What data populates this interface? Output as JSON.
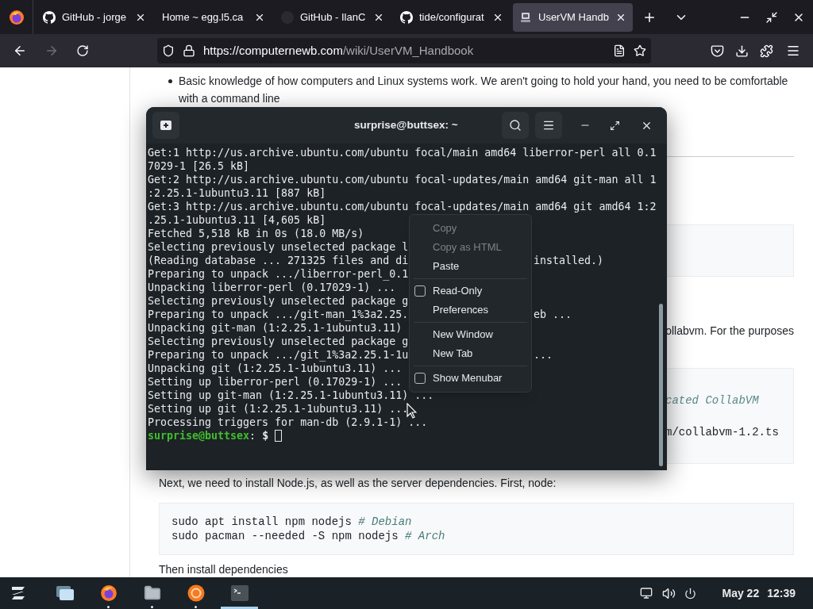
{
  "browser": {
    "tabs": [
      {
        "title": "GitHub - jorge",
        "kind": "github",
        "selected": false
      },
      {
        "title": "Home ~ egg.l5.ca",
        "kind": "plain",
        "selected": false
      },
      {
        "title": "GitHub - IlanC",
        "kind": "dark",
        "selected": false
      },
      {
        "title": "tide/configurat",
        "kind": "github",
        "selected": false
      },
      {
        "title": "UserVM Handb",
        "kind": "site",
        "selected": true
      }
    ],
    "url": {
      "host": "https://computernewb.com",
      "path": "/wiki/UserVM_Handbook"
    }
  },
  "page": {
    "bullet": "Basic knowledge of how computers and Linux systems work. We aren't going to hold your hand, you need to be comfortable with a command line",
    "fragment_paragraph": "ollabvm. For the purposes",
    "code_fragments": [
      {
        "text": "cated CollabVM",
        "kind": "comment"
      },
      {
        "text": "m/collabvm-1.2.ts",
        "kind": "command"
      }
    ],
    "intro": "Next, we need to install Node.js, as well as the server dependencies. First, node:",
    "code": [
      {
        "command": "sudo apt install npm nodejs",
        "comment": "# Debian"
      },
      {
        "command": "sudo pacman --needed -S npm nodejs",
        "comment": "# Arch"
      }
    ],
    "next_text": "Then install dependencies"
  },
  "terminal": {
    "title": "surprise@buttsex: ~",
    "lines": [
      {
        "text": "Get:1 http://us.archive.ubuntu.com/ubuntu focal/main amd64 liberror-perl all 0.1"
      },
      {
        "text": "7029-1 [26.5 kB]"
      },
      {
        "text": "Get:2 http://us.archive.ubuntu.com/ubuntu focal-updates/main amd64 git-man all 1"
      },
      {
        "text": ":2.25.1-1ubuntu3.11 [887 kB]"
      },
      {
        "text": "Get:3 http://us.archive.ubuntu.com/ubuntu focal-updates/main amd64 git amd64 1:2"
      },
      {
        "text": ".25.1-1ubuntu3.11 [4,605 kB]"
      },
      {
        "text": "Fetched 5,518 kB in 0s (18.0 MB/s)"
      },
      {
        "text": "Selecting previously unselected package l"
      },
      {
        "text": "(Reading database ... 271325 files and di",
        "tail": "installed.)"
      },
      {
        "text": "Preparing to unpack .../liberror-perl_0.1"
      },
      {
        "text": "Unpacking liberror-perl (0.17029-1) ..."
      },
      {
        "text": "Selecting previously unselected package g"
      },
      {
        "text": "Preparing to unpack .../git-man_1%3a2.25.",
        "tail": "eb ..."
      },
      {
        "text": "Unpacking git-man (1:2.25.1-1ubuntu3.11)"
      },
      {
        "text": "Selecting previously unselected package g"
      },
      {
        "text": "Preparing to unpack .../git_1%3a2.25.1-1u",
        "tail": "..."
      },
      {
        "text": "Unpacking git (1:2.25.1-1ubuntu3.11) ..."
      },
      {
        "text": "Setting up liberror-perl (0.17029-1) ..."
      },
      {
        "text": "Setting up git-man (1:2.25.1-1ubuntu3.11) ..."
      },
      {
        "text": "Setting up git (1:2.25.1-1ubuntu3.11) ..."
      },
      {
        "text": "Processing triggers for man-db (2.9.1-1) ..."
      }
    ],
    "prompt": {
      "user_host": "surprise@buttsex",
      "separator": ":",
      "symbol": "$"
    }
  },
  "context_menu": {
    "items": [
      {
        "kind": "item",
        "label": "Copy",
        "disabled": true
      },
      {
        "kind": "item",
        "label": "Copy as HTML",
        "disabled": true
      },
      {
        "kind": "item",
        "label": "Paste",
        "disabled": false
      },
      {
        "kind": "separator"
      },
      {
        "kind": "check",
        "label": "Read-Only",
        "checked": false
      },
      {
        "kind": "item",
        "label": "Preferences",
        "disabled": false
      },
      {
        "kind": "separator"
      },
      {
        "kind": "item",
        "label": "New Window",
        "disabled": false
      },
      {
        "kind": "item",
        "label": "New Tab",
        "disabled": false
      },
      {
        "kind": "separator"
      },
      {
        "kind": "check",
        "label": "Show Menubar",
        "checked": false
      }
    ]
  },
  "taskbar": {
    "apps": [
      {
        "kind": "windows",
        "running": false,
        "focused": false
      },
      {
        "kind": "browser",
        "running": true,
        "focused": false
      },
      {
        "kind": "files",
        "running": true,
        "focused": false
      },
      {
        "kind": "orange",
        "running": true,
        "focused": false
      },
      {
        "kind": "terminal",
        "running": true,
        "focused": true
      }
    ],
    "date": "May 22",
    "time": "12:39"
  }
}
